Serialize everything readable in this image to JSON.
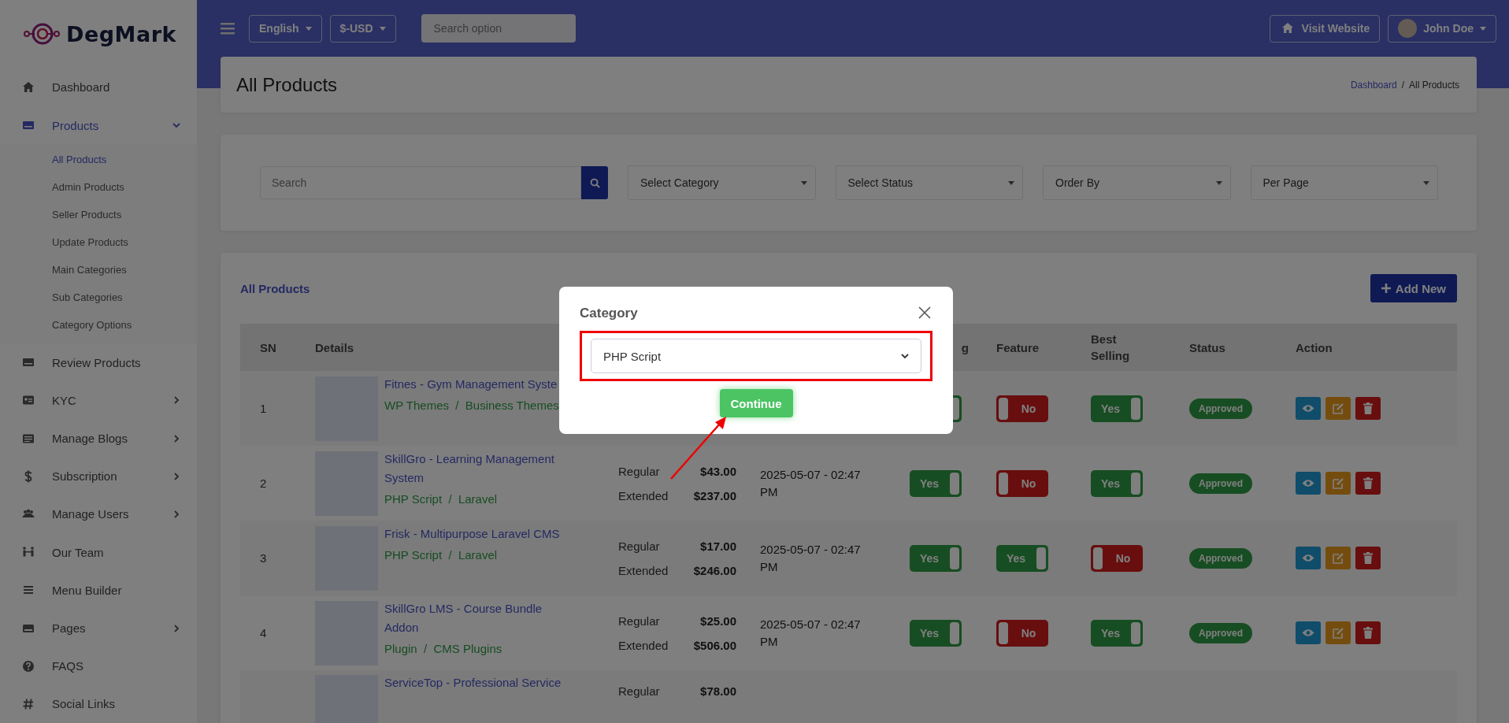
{
  "logo": {
    "text": "DegMark"
  },
  "sidebar": {
    "items": [
      {
        "label": "Dashboard",
        "selected": false
      },
      {
        "label": "Products",
        "selected": true,
        "expanded": true,
        "children": [
          {
            "label": "All Products",
            "selected": true
          },
          {
            "label": "Admin Products",
            "selected": false
          },
          {
            "label": "Seller Products",
            "selected": false
          },
          {
            "label": "Update Products",
            "selected": false
          },
          {
            "label": "Main Categories",
            "selected": false
          },
          {
            "label": "Sub Categories",
            "selected": false
          },
          {
            "label": "Category Options",
            "selected": false
          }
        ]
      },
      {
        "label": "Review Products",
        "selected": false
      },
      {
        "label": "KYC",
        "selected": false,
        "expanded": false
      },
      {
        "label": "Manage Blogs",
        "selected": false,
        "expanded": false
      },
      {
        "label": "Subscription",
        "selected": false,
        "expanded": false
      },
      {
        "label": "Manage Users",
        "selected": false,
        "expanded": false
      },
      {
        "label": "Our Team",
        "selected": false
      },
      {
        "label": "Menu Builder",
        "selected": false
      },
      {
        "label": "Pages",
        "selected": false,
        "expanded": false
      },
      {
        "label": "FAQS",
        "selected": false
      },
      {
        "label": "Social Links",
        "selected": false
      }
    ]
  },
  "topbar": {
    "language": "English",
    "currency": "$-USD",
    "search": {
      "placeholder": "Search option"
    },
    "visit_website": "Visit Website",
    "user": "John Doe"
  },
  "page_header": {
    "title": "All Products",
    "breadcrumb": [
      {
        "label": "Dashboard",
        "link": true
      },
      {
        "label": "All Products",
        "link": false
      }
    ],
    "separator": "/"
  },
  "filters": {
    "search": {
      "placeholder": "Search"
    },
    "selects": [
      "Select Category",
      "Select Status",
      "Order By",
      "Per Page"
    ]
  },
  "products": {
    "title": "All Products",
    "add_button": "Add New",
    "header": {
      "sn": "SN",
      "details": "Details",
      "column_5": "g",
      "feature": "Feature",
      "best_selling": "Best Selling",
      "status": "Status",
      "action": "Action"
    },
    "rows": [
      {
        "sn": "1",
        "title": "Fitnes - Gym Management Syste",
        "category": "WP Themes  /  Business Themes",
        "trending": {
          "on": true
        },
        "feature": {
          "on": false,
          "label": "No"
        },
        "best_selling": {
          "on": true,
          "label": "Yes"
        },
        "status": "Approved"
      },
      {
        "sn": "2",
        "title": "SkillGro - Learning Management System",
        "category": "PHP Script  /  Laravel",
        "prices": [
          {
            "label": "Regular",
            "amount": "$43.00"
          },
          {
            "label": "Extended",
            "amount": "$237.00"
          }
        ],
        "date": "2025-05-07 - 02:47 PM",
        "trending": {
          "on": true,
          "label": "Yes"
        },
        "feature": {
          "on": false,
          "label": "No"
        },
        "best_selling": {
          "on": true,
          "label": "Yes"
        },
        "status": "Approved"
      },
      {
        "sn": "3",
        "title": "Frisk - Multipurpose Laravel CMS",
        "category": "PHP Script  /  Laravel",
        "prices": [
          {
            "label": "Regular",
            "amount": "$17.00"
          },
          {
            "label": "Extended",
            "amount": "$246.00"
          }
        ],
        "date": "2025-05-07 - 02:47 PM",
        "trending": {
          "on": true,
          "label": "Yes"
        },
        "feature": {
          "on": true,
          "label": "Yes"
        },
        "best_selling": {
          "on": false,
          "label": "No"
        },
        "status": "Approved"
      },
      {
        "sn": "4",
        "title": "SkillGro LMS - Course Bundle Addon",
        "category": "Plugin  /  CMS Plugins",
        "prices": [
          {
            "label": "Regular",
            "amount": "$25.00"
          },
          {
            "label": "Extended",
            "amount": "$506.00"
          }
        ],
        "date": "2025-05-07 - 02:47 PM",
        "trending": {
          "on": true,
          "label": "Yes"
        },
        "feature": {
          "on": false,
          "label": "No"
        },
        "best_selling": {
          "on": true,
          "label": "Yes"
        },
        "status": "Approved"
      },
      {
        "title": "ServiceTop - Professional Service",
        "prices": [
          {
            "label": "Regular",
            "amount": "$78.00"
          }
        ]
      }
    ]
  },
  "modal": {
    "title": "Category",
    "select_value": "PHP Script",
    "button": "Continue"
  }
}
